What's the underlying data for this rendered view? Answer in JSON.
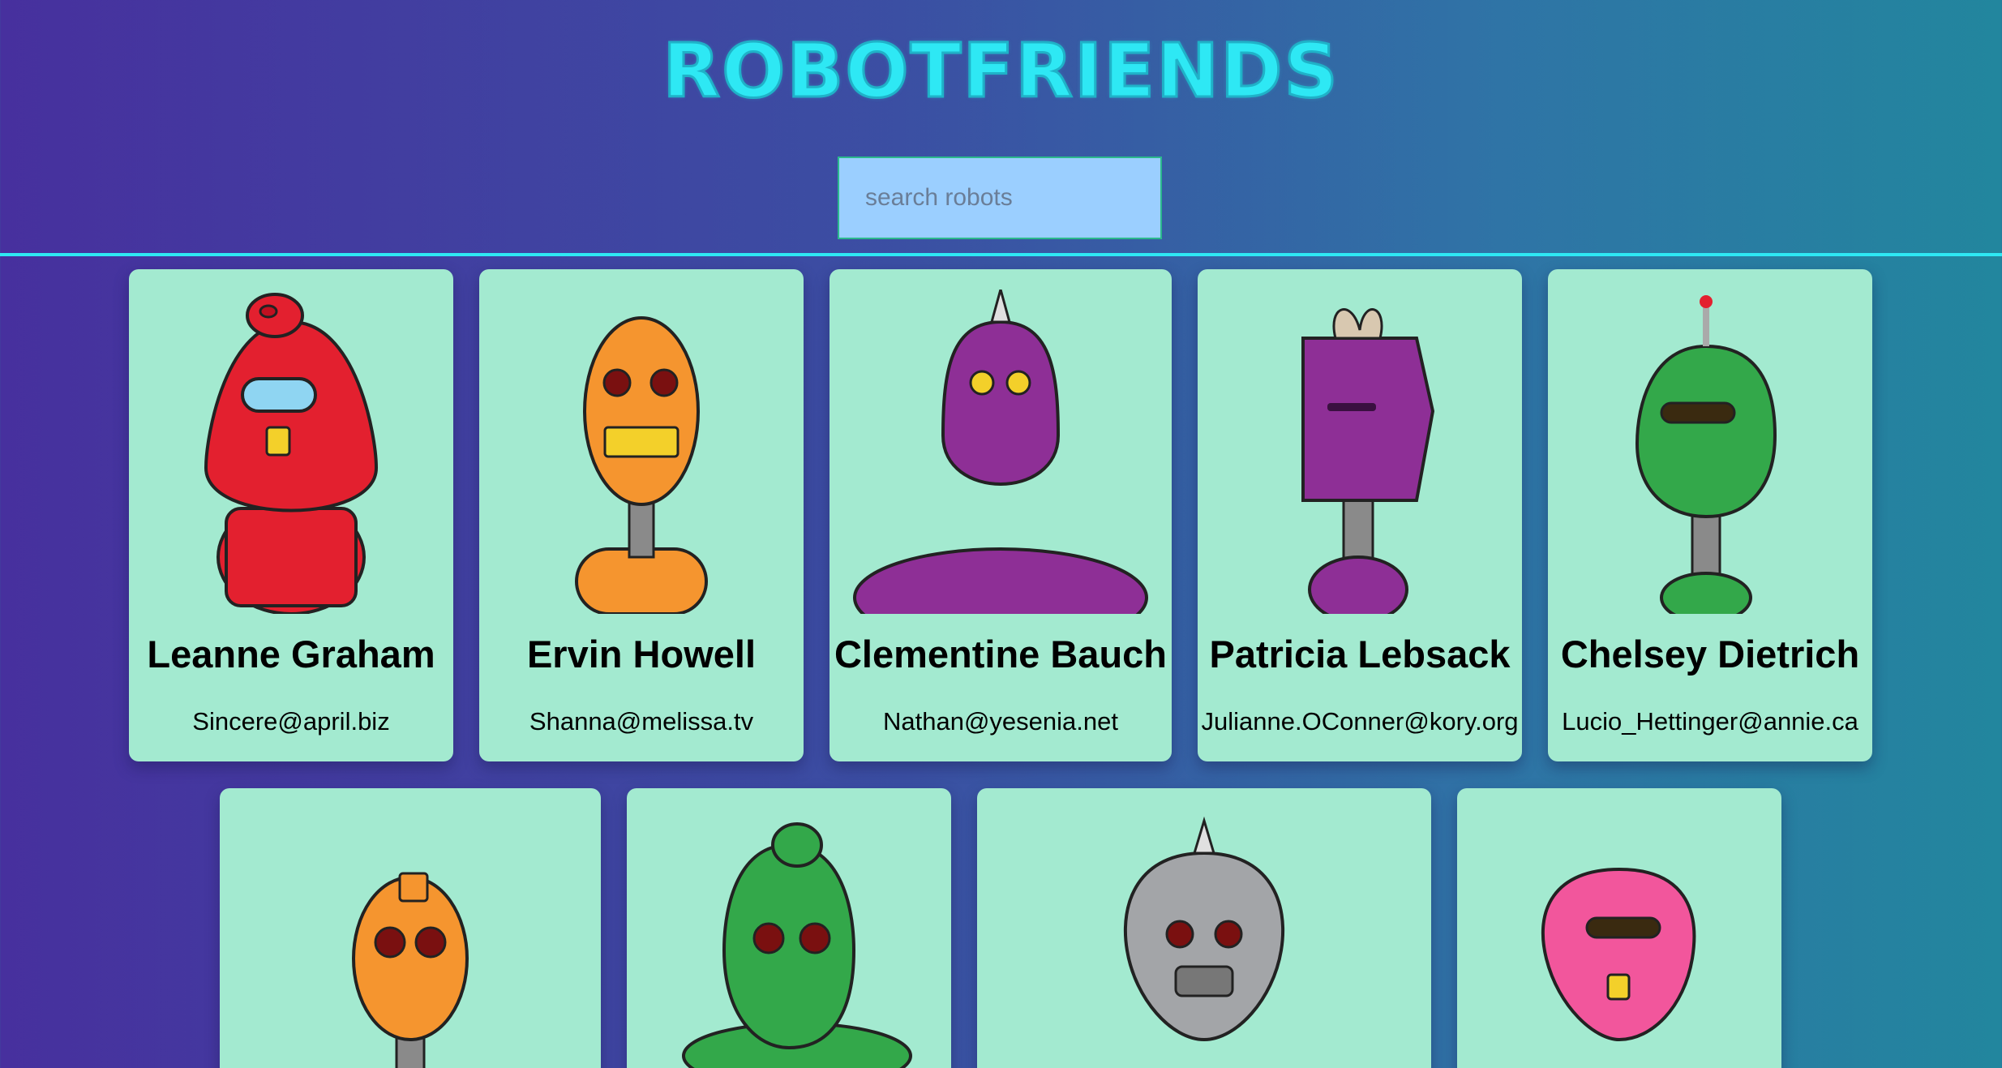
{
  "app": {
    "title": "ROBOTFRIENDS"
  },
  "search": {
    "placeholder": "search robots",
    "value": ""
  },
  "robots": [
    {
      "name": "Leanne Graham",
      "email": "Sincere@april.biz",
      "color": "#e3202f"
    },
    {
      "name": "Ervin Howell",
      "email": "Shanna@melissa.tv",
      "color": "#f5952f"
    },
    {
      "name": "Clementine Bauch",
      "email": "Nathan@yesenia.net",
      "color": "#8e2f96"
    },
    {
      "name": "Patricia Lebsack",
      "email": "Julianne.OConner@kory.org",
      "color": "#8e2f96"
    },
    {
      "name": "Chelsey Dietrich",
      "email": "Lucio_Hettinger@annie.ca",
      "color": "#33a84a"
    },
    {
      "name": "",
      "email": "",
      "color": "#f5952f"
    },
    {
      "name": "",
      "email": "",
      "color": "#33a84a"
    },
    {
      "name": "",
      "email": "",
      "color": "#a3a5a8"
    },
    {
      "name": "",
      "email": "",
      "color": "#f2569c"
    }
  ],
  "colors": {
    "accent": "#2ee8f4",
    "card": "#a3ead0",
    "search_bg": "#9bcfff"
  }
}
